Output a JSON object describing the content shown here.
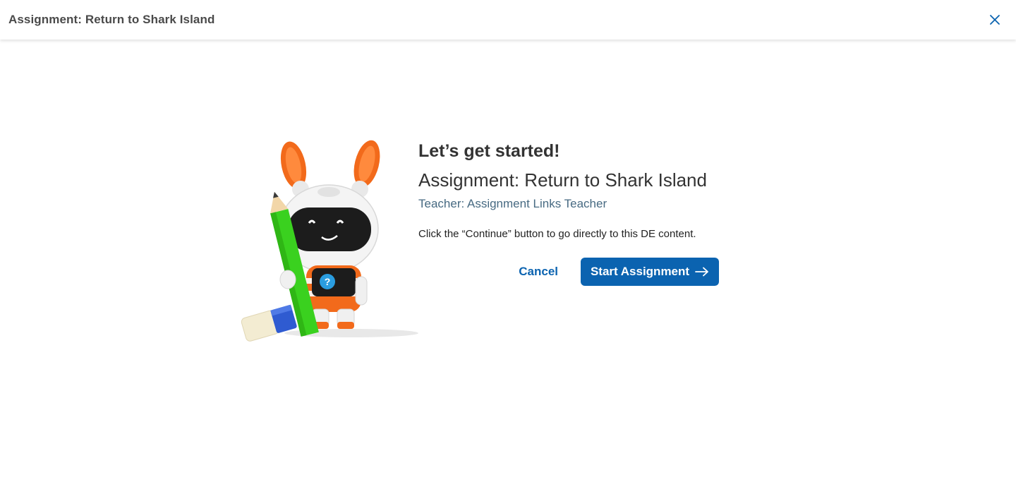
{
  "header": {
    "title": "Assignment: Return to Shark Island",
    "close_icon": "close-icon"
  },
  "main": {
    "heading": "Let’s get started!",
    "assignment_title": "Assignment: Return to Shark Island",
    "teacher": "Teacher: Assignment Links Teacher",
    "instructions": "Click the “Continue” button to go directly to this DE content.",
    "cancel_label": "Cancel",
    "start_label": "Start Assignment",
    "start_icon": "arrow-right-icon"
  },
  "colors": {
    "primary": "#0b63b0",
    "teacher_text": "#476a82",
    "mascot_orange": "#f26a1b",
    "pencil_green": "#3ad11f"
  }
}
